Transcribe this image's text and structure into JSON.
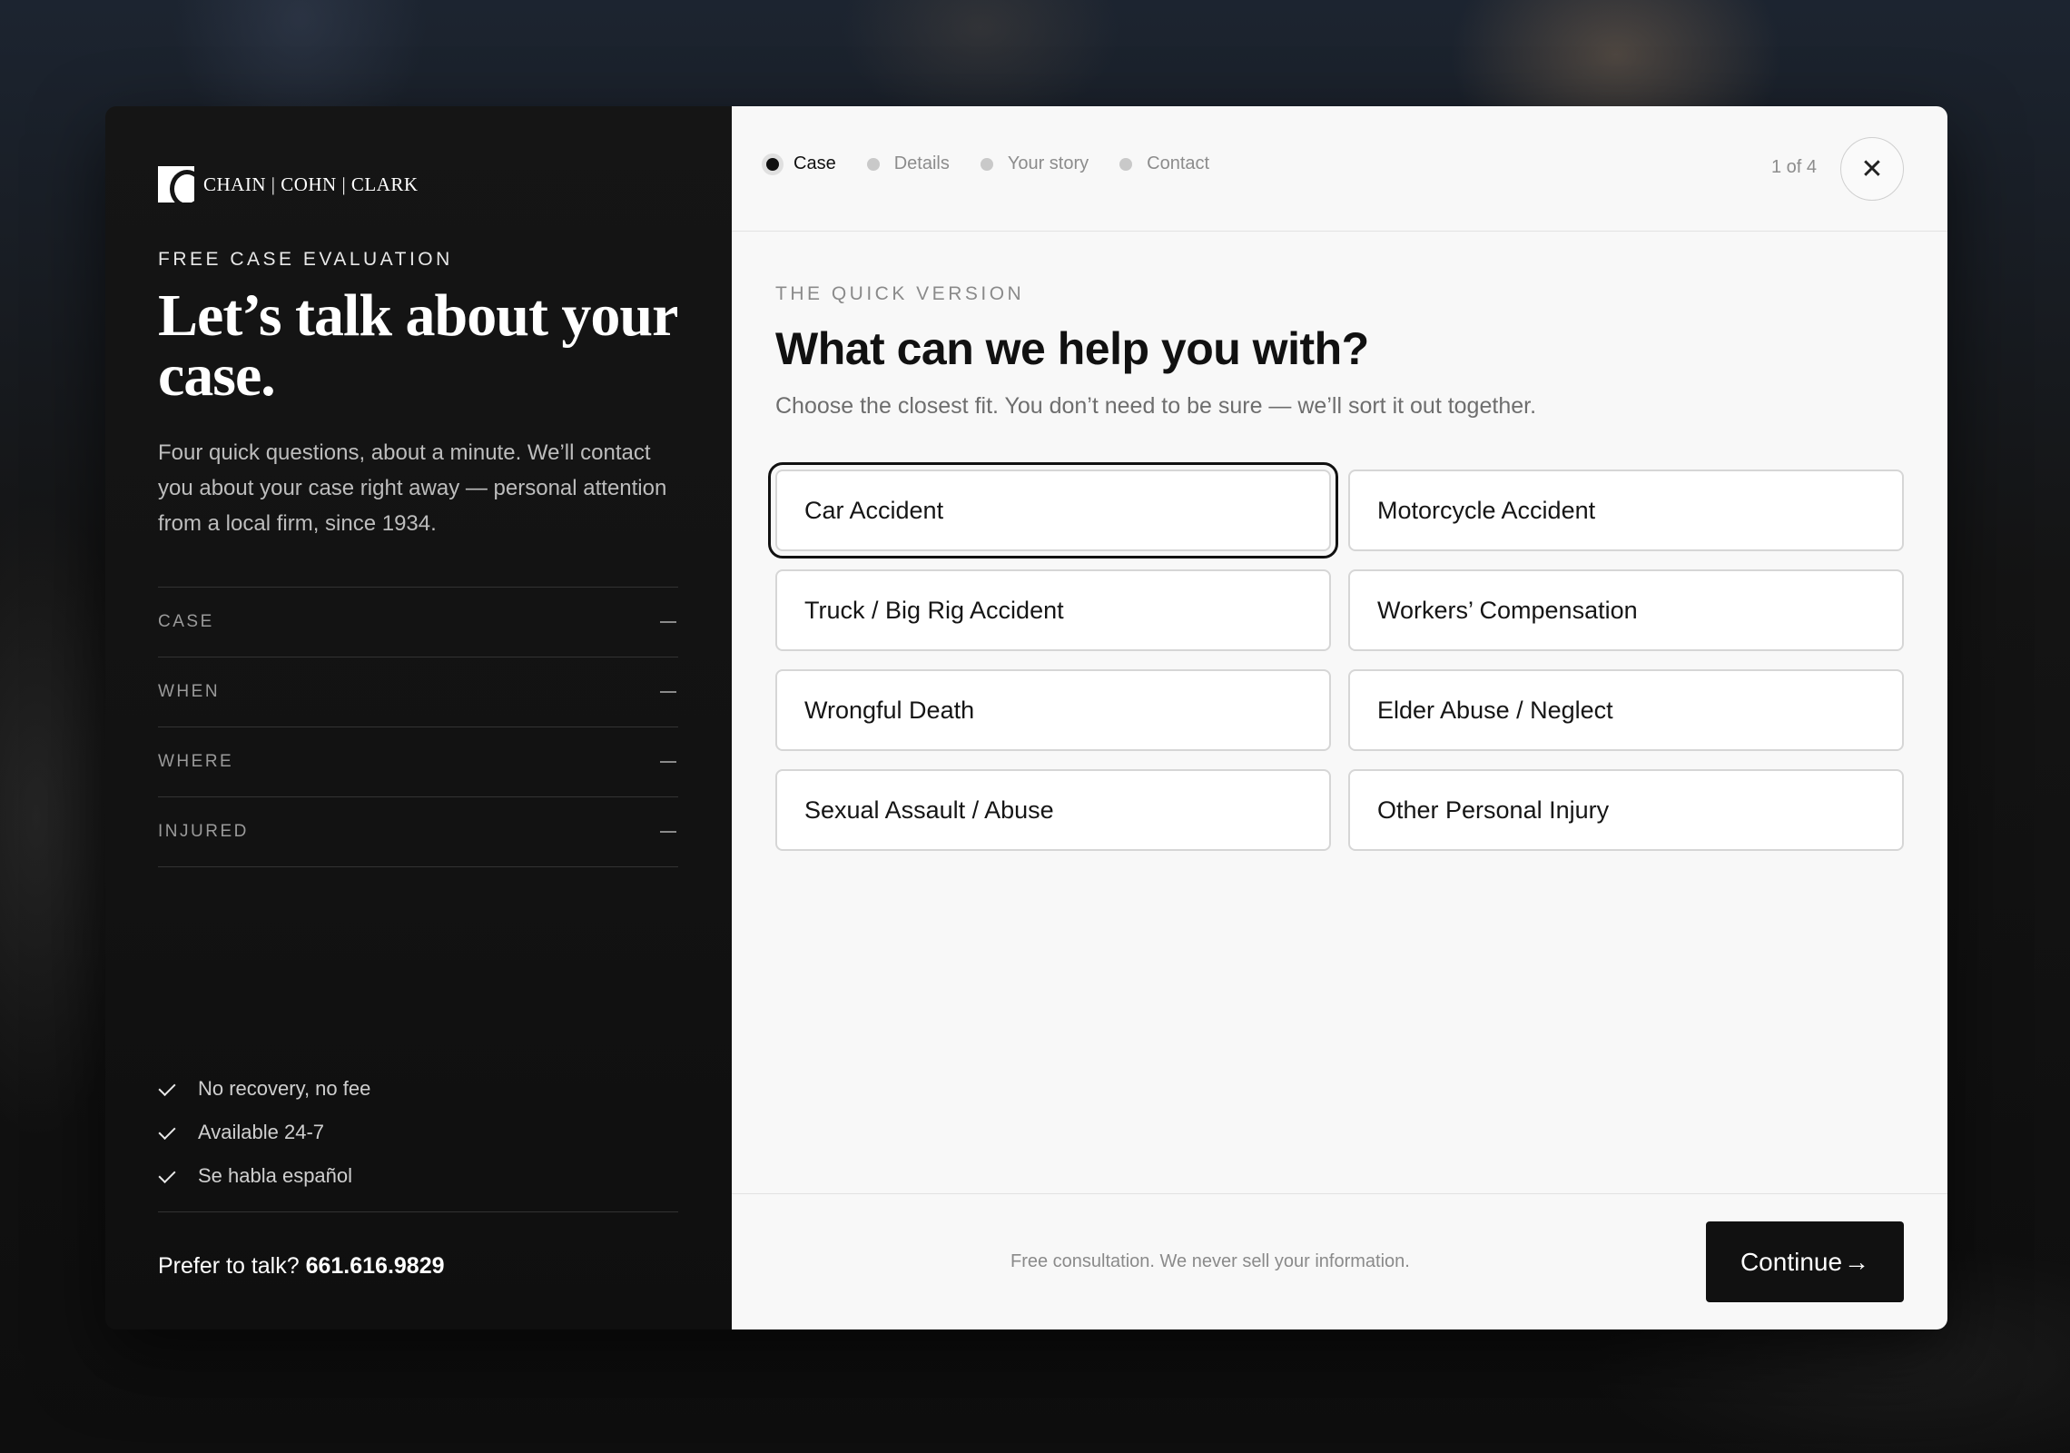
{
  "brand": {
    "name": "CHAIN | COHN | CLARK"
  },
  "left": {
    "eyebrow": "FREE CASE EVALUATION",
    "headline": "Let’s talk about your case.",
    "intro": "Four quick questions, about a minute. We’ll contact you about your case right away — personal attention from a local firm, since 1934.",
    "summary": [
      {
        "label": "CASE",
        "value": "—"
      },
      {
        "label": "WHEN",
        "value": "—"
      },
      {
        "label": "WHERE",
        "value": "—"
      },
      {
        "label": "INJURED",
        "value": "—"
      }
    ],
    "perks": [
      "No recovery, no fee",
      "Available 24-7",
      "Se habla español"
    ],
    "phone_prefix": "Prefer to talk?",
    "phone_number": "661.616.9829"
  },
  "stepper": {
    "steps": [
      {
        "label": "Case",
        "active": true
      },
      {
        "label": "Details",
        "active": false
      },
      {
        "label": "Your story",
        "active": false
      },
      {
        "label": "Contact",
        "active": false
      }
    ],
    "counter": "1 of 4",
    "close_icon": "close-icon"
  },
  "main": {
    "eyebrow": "THE QUICK VERSION",
    "question": "What can we help you with?",
    "subtext": "Choose the closest fit. You don’t need to be sure — we’ll sort it out together.",
    "options": [
      {
        "label": "Car Accident",
        "selected": true
      },
      {
        "label": "Motorcycle Accident",
        "selected": false
      },
      {
        "label": "Truck / Big Rig Accident",
        "selected": false
      },
      {
        "label": "Workers’ Compensation",
        "selected": false
      },
      {
        "label": "Wrongful Death",
        "selected": false
      },
      {
        "label": "Elder Abuse / Neglect",
        "selected": false
      },
      {
        "label": "Sexual Assault / Abuse",
        "selected": false
      },
      {
        "label": "Other Personal Injury",
        "selected": false
      }
    ]
  },
  "footer": {
    "note": "Free consultation. We never sell your information.",
    "continue_label": "Continue",
    "continue_icon": "arrow-right-icon"
  },
  "colors": {
    "accent": "#111111",
    "panel_dark": "#141414",
    "panel_light": "#f8f8f8"
  }
}
